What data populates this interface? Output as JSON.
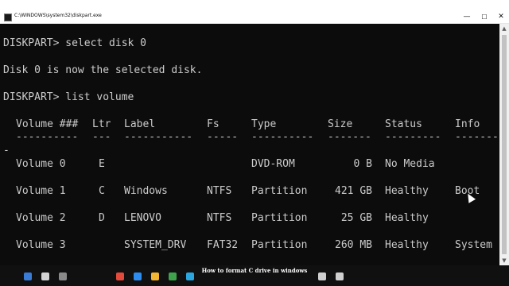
{
  "window": {
    "title": "C:\\WINDOWS\\system32\\diskpart.exe",
    "icon": "console-app-icon",
    "minimize_glyph": "—",
    "maximize_glyph": "☐",
    "close_glyph": "✕"
  },
  "console": {
    "lines": [
      "DISKPART> select disk 0",
      "Disk 0 is now the selected disk.",
      "DISKPART> list volume"
    ],
    "headers": [
      "Volume ###",
      "Ltr",
      "Label",
      "Fs",
      "Type",
      "Size",
      "Status",
      "Info"
    ],
    "separators": [
      "----------",
      "---",
      "-----------",
      "-----",
      "----------",
      "-------",
      "---------",
      "--------"
    ],
    "wrap_dash": "-",
    "volumes": [
      [
        "Volume 0",
        "E",
        "",
        "",
        "DVD-ROM",
        "0 B",
        "No Media",
        ""
      ],
      [
        "Volume 1",
        "C",
        "Windows",
        "NTFS",
        "Partition",
        "421 GB",
        "Healthy",
        "Boot"
      ],
      [
        "Volume 2",
        "D",
        "LENOVO",
        "NTFS",
        "Partition",
        "25 GB",
        "Healthy",
        ""
      ],
      [
        "Volume 3",
        "",
        "SYSTEM_DRV",
        "FAT32",
        "Partition",
        "260 MB",
        "Healthy",
        "System"
      ]
    ]
  },
  "scrollbar": {
    "up_glyph": "▲",
    "down_glyph": "▼"
  },
  "taskbar": {
    "caption": "How to format C drive in windows",
    "icons": [
      "start-icon",
      "search-icon",
      "task-view-icon",
      "browser-icon",
      "media-icon",
      "folder-icon",
      "store-icon",
      "mail-icon",
      "network-icon",
      "volume-icon"
    ],
    "icon_colors": [
      "#3a7bd5",
      "#d4d4d4",
      "#8a8a8a",
      "#e24a3b",
      "#2d8cf0",
      "#f2b632",
      "#3fa34d",
      "#2aa6e0",
      "#cfcfcf",
      "#cfcfcf"
    ]
  }
}
